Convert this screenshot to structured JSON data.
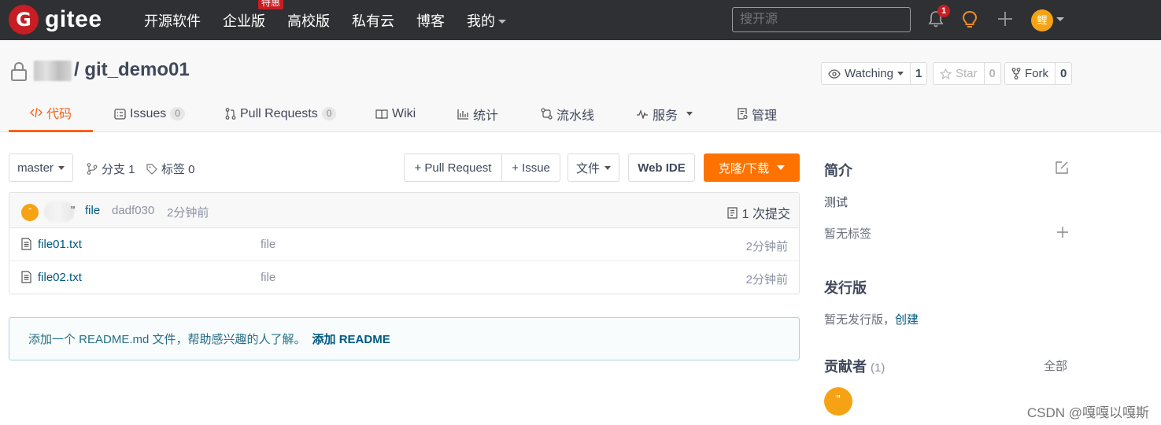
{
  "brand": {
    "logo_letter": "G",
    "name": "gitee"
  },
  "topnav": {
    "items": [
      "开源软件",
      "企业版",
      "高校版",
      "私有云",
      "博客",
      "我的"
    ],
    "hot_badge": "特惠",
    "search_placeholder": "搜开源",
    "notification_count": "1",
    "avatar_text": "鲤"
  },
  "repo": {
    "name": "/ git_demo01",
    "watching": {
      "label": "Watching",
      "count": "1"
    },
    "star": {
      "label": "Star",
      "count": "0"
    },
    "fork": {
      "label": "Fork",
      "count": "0"
    }
  },
  "tabs": [
    {
      "label": "代码",
      "active": true
    },
    {
      "label": "Issues",
      "count": "0"
    },
    {
      "label": "Pull Requests",
      "count": "0"
    },
    {
      "label": "Wiki"
    },
    {
      "label": "统计"
    },
    {
      "label": "流水线"
    },
    {
      "label": "服务"
    },
    {
      "label": "管理"
    }
  ],
  "toolbar": {
    "branch": "master",
    "branches_label": "分支 1",
    "tags_label": "标签 0",
    "pull_request_label": "+ Pull Request",
    "issue_label": "+ Issue",
    "file_label": "文件",
    "web_ide_label": "Web IDE",
    "clone_label": "克隆/下载"
  },
  "commit": {
    "avatar_text": "\"",
    "author_quote": "\"",
    "message": "file",
    "hash": "dadf030",
    "time": "2分钟前",
    "count_label": "1 次提交"
  },
  "files": [
    {
      "name": "file01.txt",
      "message": "file",
      "time": "2分钟前"
    },
    {
      "name": "file02.txt",
      "message": "file",
      "time": "2分钟前"
    }
  ],
  "readme": {
    "text": "添加一个 README.md 文件，帮助感兴趣的人了解。",
    "link": "添加 README"
  },
  "sidebar": {
    "intro_title": "简介",
    "intro_text": "测试",
    "no_tags": "暂无标签",
    "release_title": "发行版",
    "no_release": "暂无发行版，",
    "create_link": "创建",
    "contributors_title": "贡献者",
    "contributors_count": "(1)",
    "all_link": "全部",
    "contributor_avatar": "\""
  },
  "watermark": "CSDN @嘎嘎以嘎斯"
}
